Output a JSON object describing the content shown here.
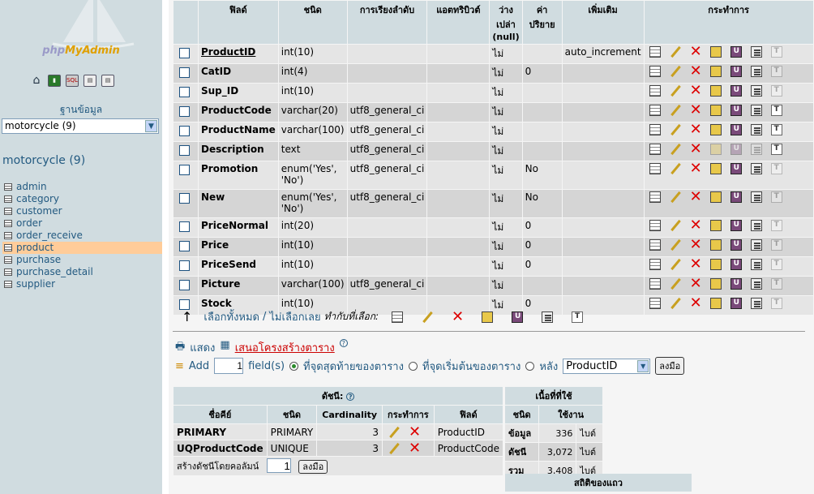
{
  "sidebar": {
    "logo_a": "php",
    "logo_b": "MyAdmin",
    "db_label": "ฐานข้อมูล",
    "db_select": "motorcycle (9)",
    "db_title": "motorcycle (9)",
    "tables": [
      "admin",
      "category",
      "customer",
      "order",
      "order_receive",
      "product",
      "purchase",
      "purchase_detail",
      "supplier"
    ],
    "active_table": "product"
  },
  "structure": {
    "headers": {
      "field": "ฟิลด์",
      "type": "ชนิด",
      "collation": "การเรียงลำดับ",
      "attributes": "แอตทริบิวต์",
      "null": "ว่าง เปล่า (null)",
      "default": "ค่า ปริยาย",
      "extra": "เพิ่มเติม",
      "action": "กระทำการ"
    },
    "rows": [
      {
        "field": "ProductID",
        "type": "int(10)",
        "collation": "",
        "attributes": "",
        "null": "ไม่",
        "default": "",
        "extra": "auto_increment"
      },
      {
        "field": "CatID",
        "type": "int(4)",
        "collation": "",
        "attributes": "",
        "null": "ไม่",
        "default": "0",
        "extra": ""
      },
      {
        "field": "Sup_ID",
        "type": "int(10)",
        "collation": "",
        "attributes": "",
        "null": "ไม่",
        "default": "",
        "extra": ""
      },
      {
        "field": "ProductCode",
        "type": "varchar(20)",
        "collation": "utf8_general_ci",
        "attributes": "",
        "null": "ไม่",
        "default": "",
        "extra": ""
      },
      {
        "field": "ProductName",
        "type": "varchar(100)",
        "collation": "utf8_general_ci",
        "attributes": "",
        "null": "ไม่",
        "default": "",
        "extra": ""
      },
      {
        "field": "Description",
        "type": "text",
        "collation": "utf8_general_ci",
        "attributes": "",
        "null": "ไม่",
        "default": "",
        "extra": ""
      },
      {
        "field": "Promotion",
        "type": "enum('Yes', 'No')",
        "collation": "utf8_general_ci",
        "attributes": "",
        "null": "ไม่",
        "default": "No",
        "extra": ""
      },
      {
        "field": "New",
        "type": "enum('Yes', 'No')",
        "collation": "utf8_general_ci",
        "attributes": "",
        "null": "ไม่",
        "default": "No",
        "extra": ""
      },
      {
        "field": "PriceNormal",
        "type": "int(20)",
        "collation": "",
        "attributes": "",
        "null": "ไม่",
        "default": "0",
        "extra": ""
      },
      {
        "field": "Price",
        "type": "int(10)",
        "collation": "",
        "attributes": "",
        "null": "ไม่",
        "default": "0",
        "extra": ""
      },
      {
        "field": "PriceSend",
        "type": "int(10)",
        "collation": "",
        "attributes": "",
        "null": "ไม่",
        "default": "0",
        "extra": ""
      },
      {
        "field": "Picture",
        "type": "varchar(100)",
        "collation": "utf8_general_ci",
        "attributes": "",
        "null": "ไม่",
        "default": "",
        "extra": ""
      },
      {
        "field": "Stock",
        "type": "int(10)",
        "collation": "",
        "attributes": "",
        "null": "ไม่",
        "default": "0",
        "extra": ""
      }
    ]
  },
  "bulk": {
    "check_all": "เลือกทั้งหมด",
    "divider": "/",
    "uncheck_all": "ไม่เลือกเลย",
    "with_selected": "ทำกับที่เลือก:"
  },
  "links": {
    "print": "แสดง",
    "propose": "เสนอโครงสร้างตาราง"
  },
  "add_field": {
    "add": "Add",
    "count": "1",
    "fields": "field(s)",
    "at_end": "ที่จุดสุดท้ายของตาราง",
    "at_begin": "ที่จุดเริ่มต้นของตาราง",
    "after": "หลัง",
    "after_field": "ProductID",
    "go": "ลงมือ"
  },
  "indexes": {
    "title": "ดัชนี:",
    "headers": [
      "ชื่อคีย์",
      "ชนิด",
      "Cardinality",
      "กระทำการ",
      "ฟิลด์"
    ],
    "rows": [
      {
        "key": "PRIMARY",
        "type": "PRIMARY",
        "cardinality": "3",
        "field": "ProductID"
      },
      {
        "key": "UQProductCode",
        "type": "UNIQUE",
        "cardinality": "3",
        "field": "ProductCode"
      }
    ],
    "create_label": "สร้างดัชนีโดยคอลัมน์",
    "create_count": "1",
    "create_go": "ลงมือ"
  },
  "space": {
    "title": "เนื้อที่ที่ใช้",
    "headers": [
      "ชนิด",
      "ใช้งาน"
    ],
    "rows": [
      {
        "type": "ข้อมูล",
        "value": "336",
        "unit": "ไบต์"
      },
      {
        "type": "ดัชนี",
        "value": "3,072",
        "unit": "ไบต์"
      },
      {
        "type": "รวม",
        "value": "3,408",
        "unit": "ไบต์"
      }
    ]
  },
  "row_stats": {
    "title": "สถิติของแถว"
  },
  "colors": {
    "sidebar_bg": "#d0dce0",
    "header_bg": "#d0dce0",
    "active_table": "#ffcc99",
    "link": "#235a81"
  }
}
